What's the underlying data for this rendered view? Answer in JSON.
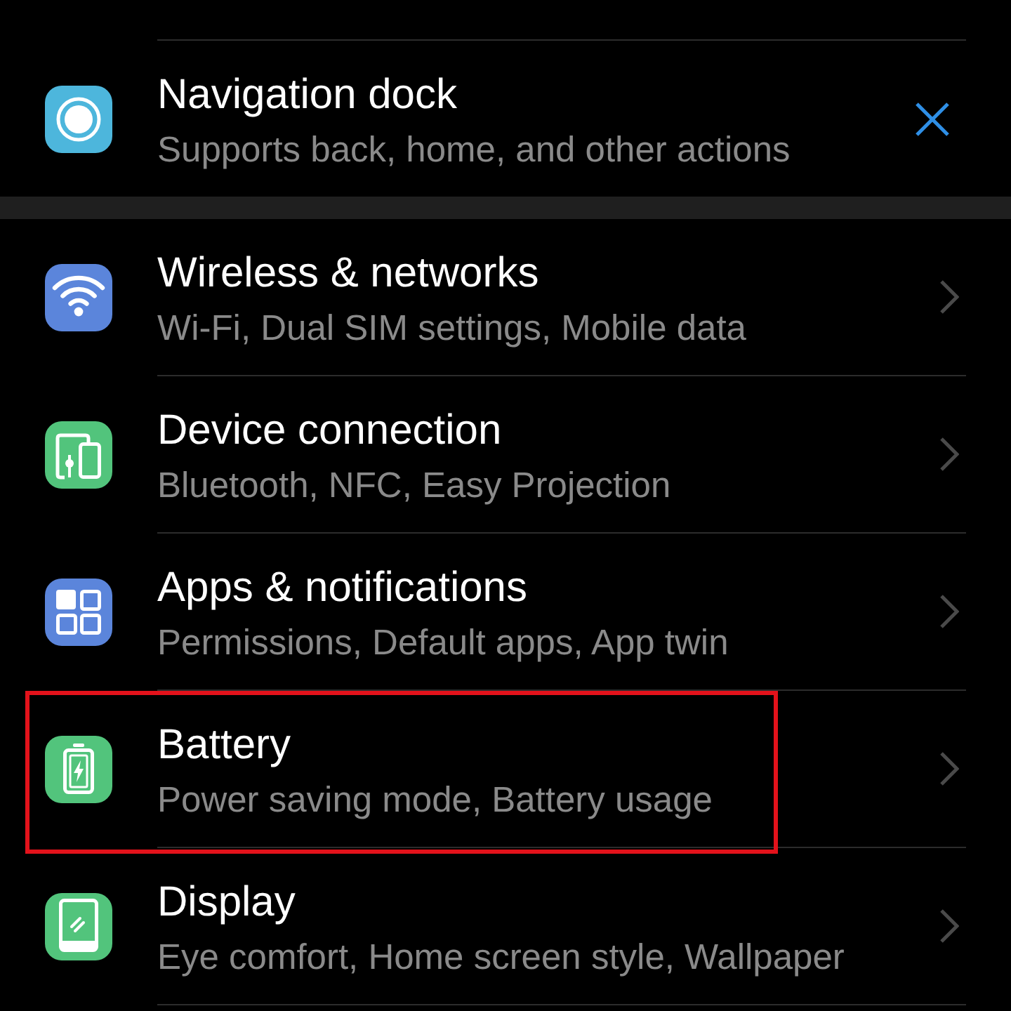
{
  "promo": {
    "title": "Navigation dock",
    "subtitle": "Supports back, home, and other actions"
  },
  "items": [
    {
      "kind": "wifi",
      "title": "Wireless & networks",
      "subtitle": "Wi-Fi, Dual SIM settings, Mobile data",
      "color": "#5b85db",
      "highlighted": false
    },
    {
      "kind": "devices",
      "title": "Device connection",
      "subtitle": "Bluetooth, NFC, Easy Projection",
      "color": "#52c47c",
      "highlighted": false
    },
    {
      "kind": "apps",
      "title": "Apps & notifications",
      "subtitle": "Permissions, Default apps, App twin",
      "color": "#5b85db",
      "highlighted": false
    },
    {
      "kind": "battery",
      "title": "Battery",
      "subtitle": "Power saving mode, Battery usage",
      "color": "#52c47c",
      "highlighted": true
    },
    {
      "kind": "display",
      "title": "Display",
      "subtitle": "Eye comfort, Home screen style, Wallpaper",
      "color": "#52c47c",
      "highlighted": false
    }
  ]
}
